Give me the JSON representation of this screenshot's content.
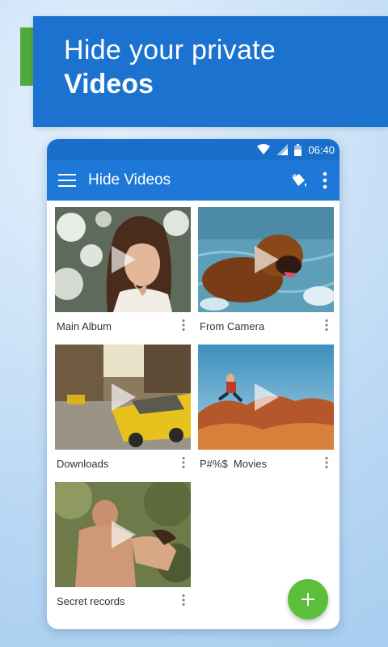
{
  "promo": {
    "line1": "Hide your private",
    "line2": "Videos",
    "banner_color": "#1c72cf",
    "accent_color": "#4faa3c"
  },
  "status_bar": {
    "time": "06:40",
    "icons": [
      "wifi-icon",
      "signal-icon",
      "battery-icon"
    ]
  },
  "app_bar": {
    "title": "Hide Videos",
    "menu_icon": "hamburger-menu-icon",
    "theme_icon": "paint-bucket-icon",
    "more_icon": "more-vertical-icon",
    "color": "#1e78d8"
  },
  "albums": [
    {
      "name": "Main Album",
      "thumbnail": "portrait-woman-snow"
    },
    {
      "name": "From Camera",
      "thumbnail": "dog-in-water"
    },
    {
      "name": "Downloads",
      "thumbnail": "yellow-taxi-street"
    },
    {
      "name": "P#%$  Movies",
      "thumbnail": "man-jumping-rocks"
    },
    {
      "name": "Secret records",
      "thumbnail": "couple-in-forest"
    }
  ],
  "fab": {
    "icon": "plus-icon",
    "color": "#5bbf3a"
  }
}
